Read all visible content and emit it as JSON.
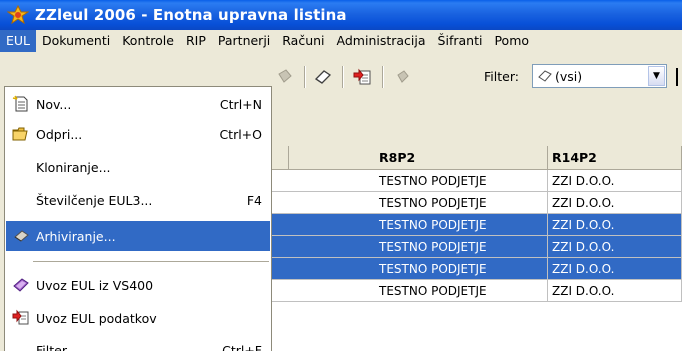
{
  "window": {
    "title": "ZZleul 2006 - Enotna upravna listina"
  },
  "menubar": {
    "items": [
      "EUL",
      "Dokumenti",
      "Kontrole",
      "RIP",
      "Partnerji",
      "Računi",
      "Administracija",
      "Šifranti",
      "Pomo"
    ]
  },
  "toolbar": {
    "filter_label": "Filter:",
    "filter_value": "(vsi)"
  },
  "grid": {
    "columns": [
      "R8P2",
      "R14P2"
    ],
    "rows": [
      {
        "c1": "TESTNO PODJETJE",
        "c2": "ZZI D.O.O.",
        "selected": false
      },
      {
        "c1": "TESTNO PODJETJE",
        "c2": "ZZI D.O.O.",
        "selected": false
      },
      {
        "c1": "TESTNO PODJETJE",
        "c2": "ZZI D.O.O.",
        "selected": true
      },
      {
        "c1": "TESTNO PODJETJE",
        "c2": "ZZI D.O.O.",
        "selected": true
      },
      {
        "c1": "TESTNO PODJETJE",
        "c2": "ZZI D.O.O.",
        "selected": true
      },
      {
        "c1": "TESTNO PODJETJE",
        "c2": "ZZI D.O.O.",
        "selected": false
      }
    ]
  },
  "eul_menu": {
    "items": [
      {
        "label": "Nov...",
        "shortcut": "Ctrl+N",
        "icon": "new-document-icon"
      },
      {
        "label": "Odpri...",
        "shortcut": "Ctrl+O",
        "icon": "open-folder-icon"
      },
      {
        "label": "Kloniranje...",
        "shortcut": "",
        "icon": ""
      },
      {
        "label": "Številčenje EUL3...",
        "shortcut": "F4",
        "icon": ""
      },
      {
        "label": "Arhiviranje...",
        "shortcut": "",
        "icon": "archive-icon",
        "selected": true
      },
      {
        "label": "Uvoz EUL iz VS400",
        "shortcut": "",
        "icon": "import-vs400-icon"
      },
      {
        "label": "Uvoz EUL podatkov",
        "shortcut": "",
        "icon": "import-data-icon"
      },
      {
        "label": "Filter",
        "shortcut": "Ctrl+F",
        "icon": ""
      }
    ]
  },
  "colors": {
    "selection": "#316ac5",
    "titlebar": "#0a5fe8"
  }
}
